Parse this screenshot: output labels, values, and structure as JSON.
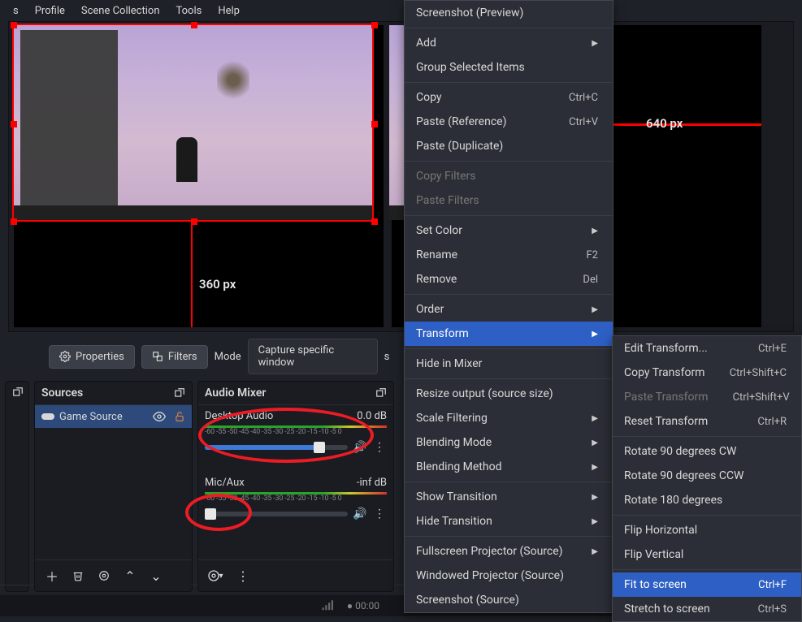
{
  "menubar": {
    "items": [
      "s",
      "Profile",
      "Scene Collection",
      "Tools",
      "Help"
    ]
  },
  "preview": {
    "height_label": "360 px",
    "width_label": "640 px"
  },
  "mid_toolbar": {
    "properties": "Properties",
    "filters": "Filters",
    "mode_label": "Mode",
    "mode_value": "Capture specific window",
    "s": "s"
  },
  "sources": {
    "title": "Sources",
    "items": [
      {
        "name": "Game Source"
      }
    ]
  },
  "mixer": {
    "title": "Audio Mixer",
    "tracks": [
      {
        "name": "Desktop Audio",
        "level": "0.0 dB",
        "ticks": "-60 -55 -50 -45 -40 -35 -30 -25 -20 -15 -10  -5   0",
        "fill": 80
      },
      {
        "name": "Mic/Aux",
        "level": "-inf dB",
        "ticks": "-60 -55 -50 -45 -40 -35 -30 -25 -20 -15 -10  -5   0",
        "fill": 4
      }
    ]
  },
  "status": {
    "time": "00:00"
  },
  "ctx_main": {
    "items": [
      {
        "label": "Screenshot (Preview)"
      },
      {
        "sep": true
      },
      {
        "label": "Add",
        "sub": true
      },
      {
        "label": "Group Selected Items"
      },
      {
        "sep": true
      },
      {
        "label": "Copy",
        "shortcut": "Ctrl+C"
      },
      {
        "label": "Paste (Reference)",
        "shortcut": "Ctrl+V"
      },
      {
        "label": "Paste (Duplicate)"
      },
      {
        "sep": true
      },
      {
        "label": "Copy Filters",
        "disabled": true
      },
      {
        "label": "Paste Filters",
        "disabled": true
      },
      {
        "sep": true
      },
      {
        "label": "Set Color",
        "sub": true
      },
      {
        "label": "Rename",
        "shortcut": "F2"
      },
      {
        "label": "Remove",
        "shortcut": "Del"
      },
      {
        "sep": true
      },
      {
        "label": "Order",
        "sub": true
      },
      {
        "label": "Transform",
        "sub": true,
        "hl": true
      },
      {
        "sep": true
      },
      {
        "label": "Hide in Mixer"
      },
      {
        "sep": true
      },
      {
        "label": "Resize output (source size)"
      },
      {
        "label": "Scale Filtering",
        "sub": true
      },
      {
        "label": "Blending Mode",
        "sub": true
      },
      {
        "label": "Blending Method",
        "sub": true
      },
      {
        "sep": true
      },
      {
        "label": "Show Transition",
        "sub": true
      },
      {
        "label": "Hide Transition",
        "sub": true
      },
      {
        "sep": true
      },
      {
        "label": "Fullscreen Projector (Source)",
        "sub": true
      },
      {
        "label": "Windowed Projector (Source)"
      },
      {
        "label": "Screenshot (Source)"
      }
    ]
  },
  "ctx_sub": {
    "items": [
      {
        "label": "Edit Transform...",
        "shortcut": "Ctrl+E"
      },
      {
        "label": "Copy Transform",
        "shortcut": "Ctrl+Shift+C"
      },
      {
        "label": "Paste Transform",
        "shortcut": "Ctrl+Shift+V",
        "disabled": true
      },
      {
        "label": "Reset Transform",
        "shortcut": "Ctrl+R"
      },
      {
        "sep": true
      },
      {
        "label": "Rotate 90 degrees CW"
      },
      {
        "label": "Rotate 90 degrees CCW"
      },
      {
        "label": "Rotate 180 degrees"
      },
      {
        "sep": true
      },
      {
        "label": "Flip Horizontal"
      },
      {
        "label": "Flip Vertical"
      },
      {
        "sep": true
      },
      {
        "label": "Fit to screen",
        "shortcut": "Ctrl+F",
        "hl": true
      },
      {
        "label": "Stretch to screen",
        "shortcut": "Ctrl+S"
      }
    ]
  }
}
